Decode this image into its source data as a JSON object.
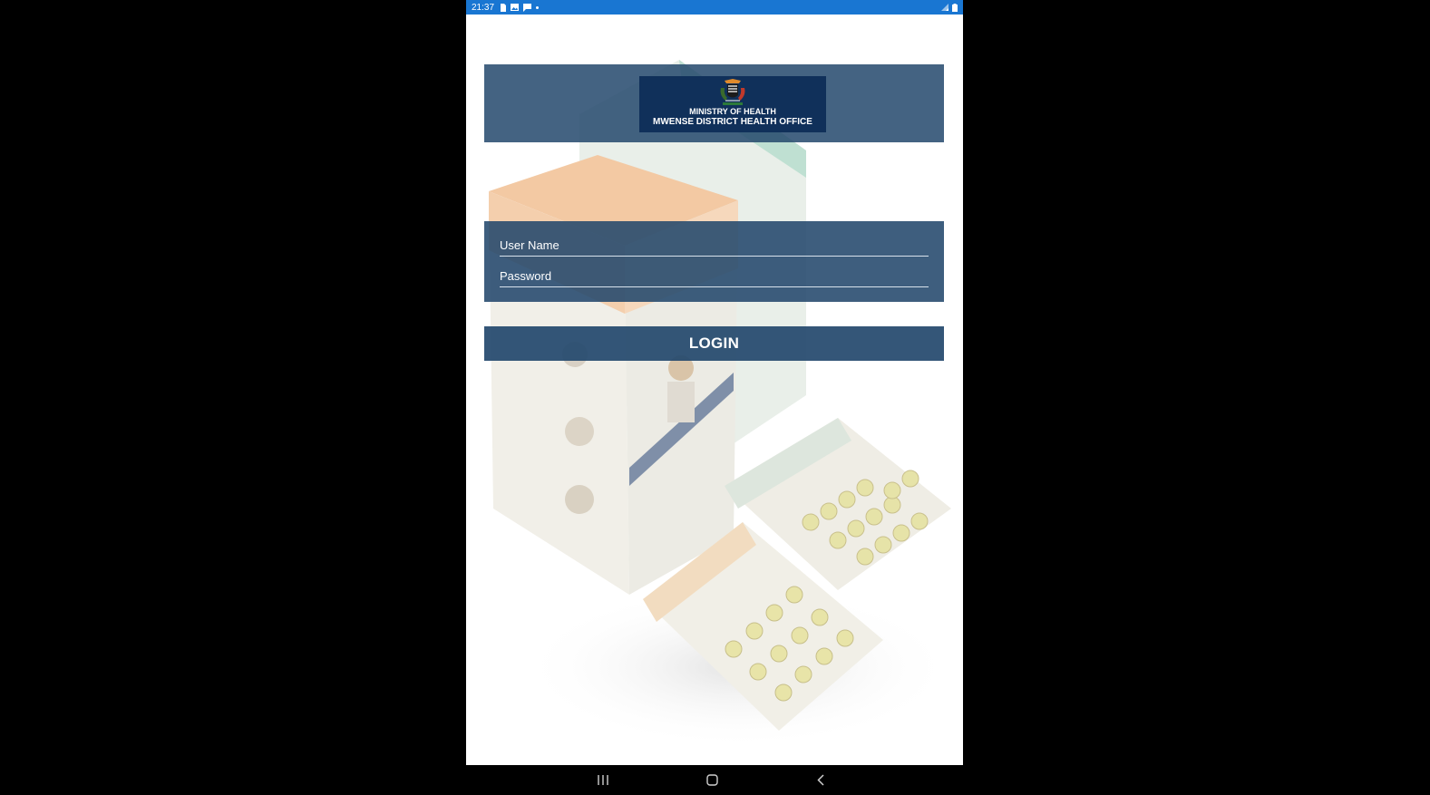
{
  "status_bar": {
    "time": "21:37",
    "bg_color": "#1976d2",
    "left_icons": [
      "sd-card-icon",
      "image-icon",
      "message-icon",
      "dot-icon"
    ],
    "right_icons": [
      "signal-icon",
      "battery-icon"
    ]
  },
  "header": {
    "crest": "zambia-coat-of-arms",
    "ministry": "MINISTRY OF HEALTH",
    "office": "MWENSE DISTRICT HEALTH OFFICE"
  },
  "form": {
    "username_placeholder": "User Name",
    "username_value": "",
    "password_placeholder": "Password",
    "password_value": ""
  },
  "login_button": {
    "label": "LOGIN"
  },
  "nav": {
    "icons": [
      "recents-icon",
      "home-icon",
      "back-icon"
    ]
  },
  "colors": {
    "panel": "#23486c",
    "logo_bg": "#10305a",
    "status_bar": "#1976d2"
  }
}
